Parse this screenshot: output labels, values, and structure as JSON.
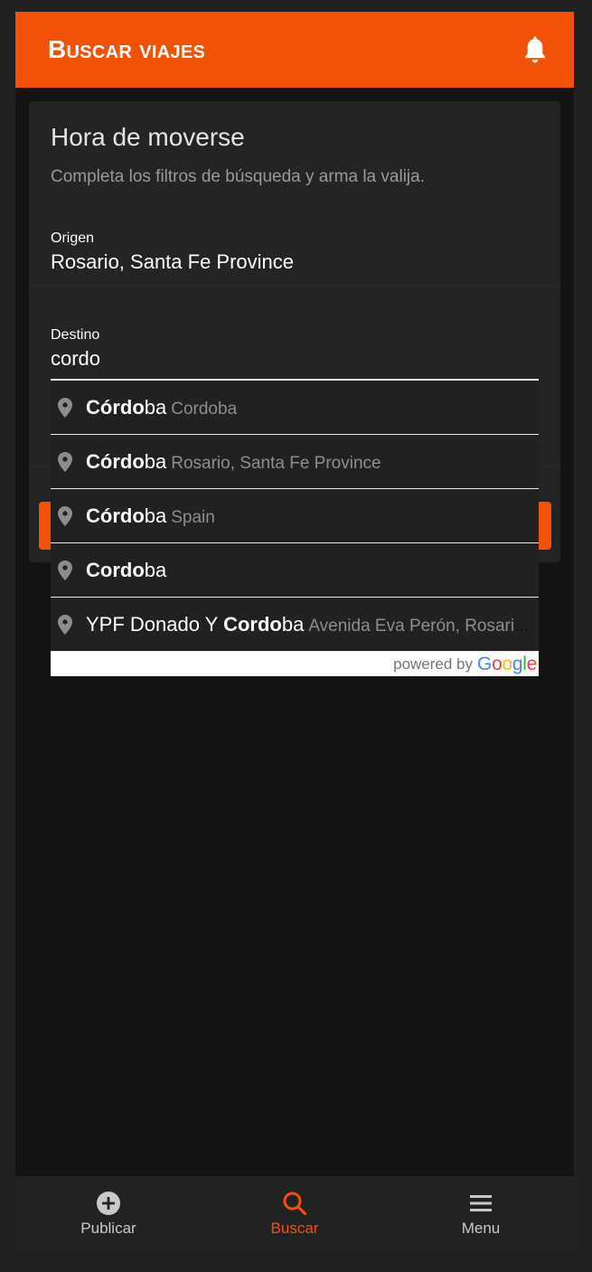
{
  "appbar": {
    "title": "Buscar viajes",
    "icon": "bell-icon"
  },
  "card": {
    "title": "Hora de moverse",
    "subtitle": "Completa los filtros de búsqueda y arma la valija."
  },
  "origin": {
    "label": "Origen",
    "value": "Rosario, Santa Fe Province"
  },
  "destination": {
    "label": "Destino",
    "value": "cordo"
  },
  "suggestions": [
    {
      "prefix": "",
      "match": "Córdo",
      "rest": "ba",
      "secondary": "Cordoba"
    },
    {
      "prefix": "",
      "match": "Córdo",
      "rest": "ba",
      "secondary": "Rosario, Santa Fe Province"
    },
    {
      "prefix": "",
      "match": "Córdo",
      "rest": "ba",
      "secondary": "Spain"
    },
    {
      "prefix": "",
      "match": "Cordo",
      "rest": "ba",
      "secondary": ""
    },
    {
      "prefix": "YPF Donado Y ",
      "match": "Cordo",
      "rest": "ba",
      "secondary": "Avenida Eva Perón, Rosario, Santa Fe Province"
    }
  ],
  "attribution": {
    "text": "powered by",
    "logo": "Google"
  },
  "nav": {
    "items": [
      {
        "label": "Publicar",
        "icon": "plus-circle-icon"
      },
      {
        "label": "Buscar",
        "icon": "search-icon"
      },
      {
        "label": "Menu",
        "icon": "menu-icon"
      }
    ]
  },
  "colors": {
    "accent": "#f25207",
    "background": "#131313",
    "card": "#242424"
  }
}
